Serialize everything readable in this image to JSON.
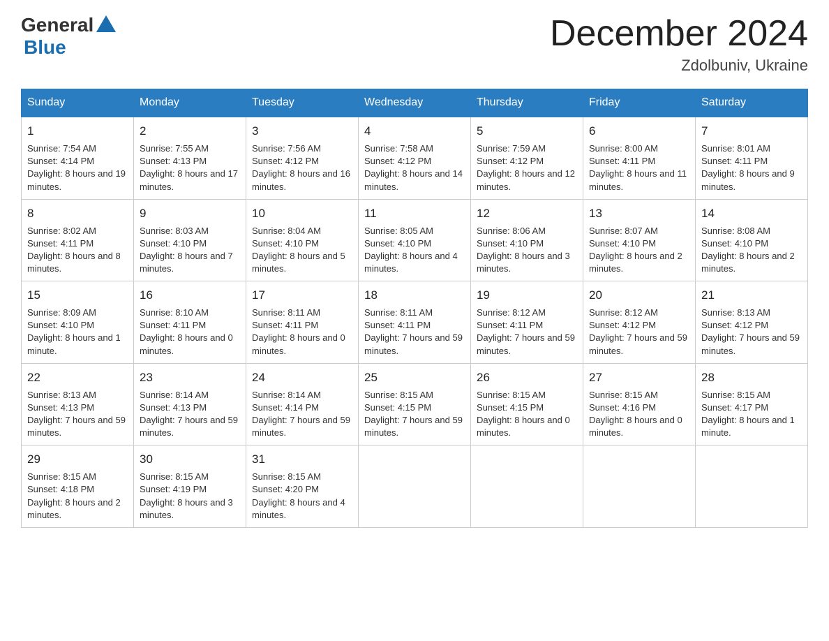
{
  "header": {
    "logo_general": "General",
    "logo_blue": "Blue",
    "month_title": "December 2024",
    "location": "Zdolbuniv, Ukraine"
  },
  "days_of_week": [
    "Sunday",
    "Monday",
    "Tuesday",
    "Wednesday",
    "Thursday",
    "Friday",
    "Saturday"
  ],
  "weeks": [
    [
      {
        "day": "1",
        "sunrise": "7:54 AM",
        "sunset": "4:14 PM",
        "daylight": "8 hours and 19 minutes."
      },
      {
        "day": "2",
        "sunrise": "7:55 AM",
        "sunset": "4:13 PM",
        "daylight": "8 hours and 17 minutes."
      },
      {
        "day": "3",
        "sunrise": "7:56 AM",
        "sunset": "4:12 PM",
        "daylight": "8 hours and 16 minutes."
      },
      {
        "day": "4",
        "sunrise": "7:58 AM",
        "sunset": "4:12 PM",
        "daylight": "8 hours and 14 minutes."
      },
      {
        "day": "5",
        "sunrise": "7:59 AM",
        "sunset": "4:12 PM",
        "daylight": "8 hours and 12 minutes."
      },
      {
        "day": "6",
        "sunrise": "8:00 AM",
        "sunset": "4:11 PM",
        "daylight": "8 hours and 11 minutes."
      },
      {
        "day": "7",
        "sunrise": "8:01 AM",
        "sunset": "4:11 PM",
        "daylight": "8 hours and 9 minutes."
      }
    ],
    [
      {
        "day": "8",
        "sunrise": "8:02 AM",
        "sunset": "4:11 PM",
        "daylight": "8 hours and 8 minutes."
      },
      {
        "day": "9",
        "sunrise": "8:03 AM",
        "sunset": "4:10 PM",
        "daylight": "8 hours and 7 minutes."
      },
      {
        "day": "10",
        "sunrise": "8:04 AM",
        "sunset": "4:10 PM",
        "daylight": "8 hours and 5 minutes."
      },
      {
        "day": "11",
        "sunrise": "8:05 AM",
        "sunset": "4:10 PM",
        "daylight": "8 hours and 4 minutes."
      },
      {
        "day": "12",
        "sunrise": "8:06 AM",
        "sunset": "4:10 PM",
        "daylight": "8 hours and 3 minutes."
      },
      {
        "day": "13",
        "sunrise": "8:07 AM",
        "sunset": "4:10 PM",
        "daylight": "8 hours and 2 minutes."
      },
      {
        "day": "14",
        "sunrise": "8:08 AM",
        "sunset": "4:10 PM",
        "daylight": "8 hours and 2 minutes."
      }
    ],
    [
      {
        "day": "15",
        "sunrise": "8:09 AM",
        "sunset": "4:10 PM",
        "daylight": "8 hours and 1 minute."
      },
      {
        "day": "16",
        "sunrise": "8:10 AM",
        "sunset": "4:11 PM",
        "daylight": "8 hours and 0 minutes."
      },
      {
        "day": "17",
        "sunrise": "8:11 AM",
        "sunset": "4:11 PM",
        "daylight": "8 hours and 0 minutes."
      },
      {
        "day": "18",
        "sunrise": "8:11 AM",
        "sunset": "4:11 PM",
        "daylight": "7 hours and 59 minutes."
      },
      {
        "day": "19",
        "sunrise": "8:12 AM",
        "sunset": "4:11 PM",
        "daylight": "7 hours and 59 minutes."
      },
      {
        "day": "20",
        "sunrise": "8:12 AM",
        "sunset": "4:12 PM",
        "daylight": "7 hours and 59 minutes."
      },
      {
        "day": "21",
        "sunrise": "8:13 AM",
        "sunset": "4:12 PM",
        "daylight": "7 hours and 59 minutes."
      }
    ],
    [
      {
        "day": "22",
        "sunrise": "8:13 AM",
        "sunset": "4:13 PM",
        "daylight": "7 hours and 59 minutes."
      },
      {
        "day": "23",
        "sunrise": "8:14 AM",
        "sunset": "4:13 PM",
        "daylight": "7 hours and 59 minutes."
      },
      {
        "day": "24",
        "sunrise": "8:14 AM",
        "sunset": "4:14 PM",
        "daylight": "7 hours and 59 minutes."
      },
      {
        "day": "25",
        "sunrise": "8:15 AM",
        "sunset": "4:15 PM",
        "daylight": "7 hours and 59 minutes."
      },
      {
        "day": "26",
        "sunrise": "8:15 AM",
        "sunset": "4:15 PM",
        "daylight": "8 hours and 0 minutes."
      },
      {
        "day": "27",
        "sunrise": "8:15 AM",
        "sunset": "4:16 PM",
        "daylight": "8 hours and 0 minutes."
      },
      {
        "day": "28",
        "sunrise": "8:15 AM",
        "sunset": "4:17 PM",
        "daylight": "8 hours and 1 minute."
      }
    ],
    [
      {
        "day": "29",
        "sunrise": "8:15 AM",
        "sunset": "4:18 PM",
        "daylight": "8 hours and 2 minutes."
      },
      {
        "day": "30",
        "sunrise": "8:15 AM",
        "sunset": "4:19 PM",
        "daylight": "8 hours and 3 minutes."
      },
      {
        "day": "31",
        "sunrise": "8:15 AM",
        "sunset": "4:20 PM",
        "daylight": "8 hours and 4 minutes."
      },
      null,
      null,
      null,
      null
    ]
  ]
}
